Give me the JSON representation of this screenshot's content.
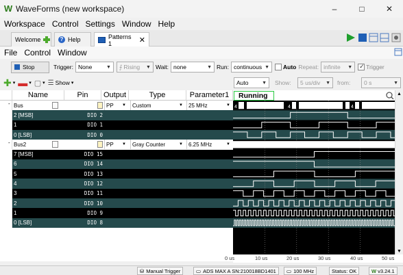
{
  "window": {
    "title": "WaveForms (new workspace)",
    "minimize": "–",
    "maximize": "□",
    "close": "✕"
  },
  "menu": {
    "items": [
      "Workspace",
      "Control",
      "Settings",
      "Window",
      "Help"
    ]
  },
  "tabs": [
    {
      "label": "Welcome",
      "icon": "plus-icon"
    },
    {
      "label": "Help",
      "icon": "help-icon"
    },
    {
      "label": "Patterns 1",
      "icon": "patterns-icon",
      "active": true,
      "close": "✕"
    }
  ],
  "submenu": {
    "items": [
      "File",
      "Control",
      "Window"
    ]
  },
  "control": {
    "stop": "Stop",
    "trigger_label": "Trigger:",
    "trigger_value": "None",
    "edge_value": "Rising",
    "wait_label": "Wait:",
    "wait_value": "none",
    "run_label": "Run:",
    "run_value": "continuous",
    "auto_label": "Auto",
    "repeat_label": "Repeat:",
    "repeat_value": "infinite",
    "trigger_chk_label": "Trigger"
  },
  "toolbar2": {
    "show_label": "Show",
    "timebase_mode": "Auto",
    "show2_label": "Show:",
    "show2_value": "5 us/div",
    "from_label": "from:",
    "from_value": "0 s"
  },
  "columns": [
    "Name",
    "Pin",
    "Output",
    "Type",
    "Parameter1"
  ],
  "running": "Running",
  "rows": [
    {
      "name": "Bus",
      "pin": "",
      "output": "PP",
      "type": "Custom",
      "param": "25 MHz",
      "bus": true
    },
    {
      "name": "2 [MSB]",
      "pin": "DIO 2"
    },
    {
      "name": "1",
      "pin": "DIO 1"
    },
    {
      "name": "0 [LSB]",
      "pin": "DIO 0"
    },
    {
      "name": "Bus2",
      "pin": "",
      "output": "PP",
      "type": "Gray Counter",
      "param": "6.25 MHz",
      "bus": true
    },
    {
      "name": "7 [MSB]",
      "pin": "DIO 15"
    },
    {
      "name": "6",
      "pin": "DIO 14"
    },
    {
      "name": "5",
      "pin": "DIO 13"
    },
    {
      "name": "4",
      "pin": "DIO 12"
    },
    {
      "name": "3",
      "pin": "DIO 11"
    },
    {
      "name": "2",
      "pin": "DIO 10"
    },
    {
      "name": "1",
      "pin": "DIO 9"
    },
    {
      "name": "0 [LSB]",
      "pin": "DIO 8"
    }
  ],
  "bus_values": [
    "4",
    "4",
    "4"
  ],
  "xaxis": [
    "0 us",
    "10 us",
    "20 us",
    "30 us",
    "40 us",
    "50 us"
  ],
  "status": {
    "manual_trigger": "Manual Trigger",
    "device": "ADS MAX A SN:210018BD1401",
    "clock": "100 MHz",
    "state": "Status: OK",
    "version": "v3.24.1"
  },
  "colors": {
    "accent_green": "#27c93f",
    "bus_dark": "#254a4c",
    "wave_line": "#ffffff"
  }
}
